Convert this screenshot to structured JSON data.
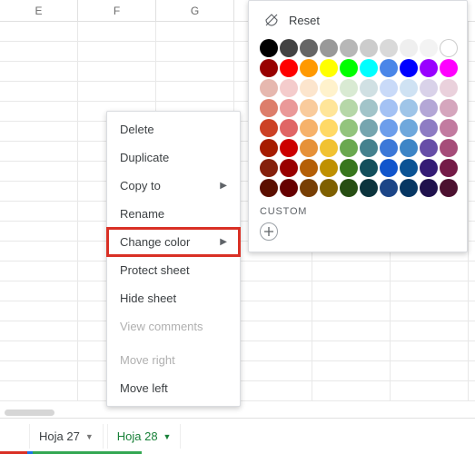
{
  "columns": [
    "E",
    "F",
    "G"
  ],
  "row_count": 19,
  "context_menu": {
    "delete": "Delete",
    "duplicate": "Duplicate",
    "copy_to": "Copy to",
    "rename": "Rename",
    "change_color": "Change color",
    "protect_sheet": "Protect sheet",
    "hide_sheet": "Hide sheet",
    "view_comments": "View comments",
    "move_right": "Move right",
    "move_left": "Move left"
  },
  "color_panel": {
    "reset": "Reset",
    "custom_label": "CUSTOM",
    "swatches": [
      [
        "#000000",
        "#434343",
        "#666666",
        "#999999",
        "#b7b7b7",
        "#cccccc",
        "#d9d9d9",
        "#efefef",
        "#f3f3f3",
        "#ffffff"
      ],
      [
        "#980000",
        "#ff0000",
        "#ff9900",
        "#ffff00",
        "#00ff00",
        "#00ffff",
        "#4a86e8",
        "#0000ff",
        "#9900ff",
        "#ff00ff"
      ],
      [
        "#e6b8af",
        "#f4cccc",
        "#fce5cd",
        "#fff2cc",
        "#d9ead3",
        "#d0e0e3",
        "#c9daf8",
        "#cfe2f3",
        "#d9d2e9",
        "#ead1dc"
      ],
      [
        "#dd7e6b",
        "#ea9999",
        "#f9cb9c",
        "#ffe599",
        "#b6d7a8",
        "#a2c4c9",
        "#a4c2f4",
        "#9fc5e8",
        "#b4a7d6",
        "#d5a6bd"
      ],
      [
        "#cc4125",
        "#e06666",
        "#f6b26b",
        "#ffd966",
        "#93c47d",
        "#76a5af",
        "#6d9eeb",
        "#6fa8dc",
        "#8e7cc3",
        "#c27ba0"
      ],
      [
        "#a61c00",
        "#cc0000",
        "#e69138",
        "#f1c232",
        "#6aa84f",
        "#45818e",
        "#3c78d8",
        "#3d85c6",
        "#674ea7",
        "#a64d79"
      ],
      [
        "#85200c",
        "#990000",
        "#b45f06",
        "#bf9000",
        "#38761d",
        "#134f5c",
        "#1155cc",
        "#0b5394",
        "#351c75",
        "#741b47"
      ],
      [
        "#5b0f00",
        "#660000",
        "#783f04",
        "#7f6000",
        "#274e13",
        "#0c343d",
        "#1c4587",
        "#073763",
        "#20124d",
        "#4c1130"
      ]
    ]
  },
  "tabs": {
    "tab1": "Hoja 27",
    "tab2": "Hoja 28"
  }
}
